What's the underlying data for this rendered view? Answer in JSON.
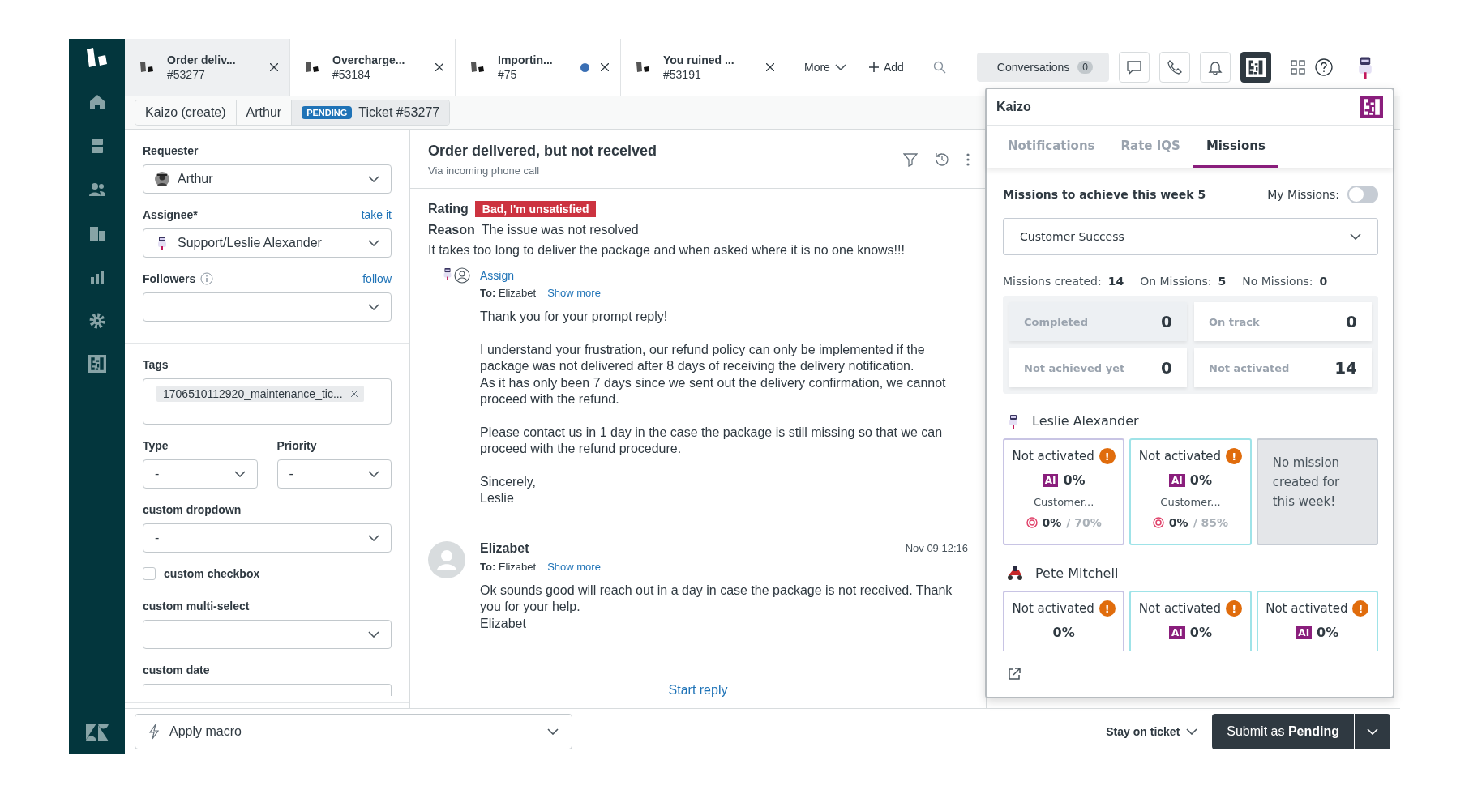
{
  "tabs": [
    {
      "title": "Order deliv...",
      "number": "#53277",
      "selected": true,
      "unread": false
    },
    {
      "title": "Overcharge...",
      "number": "#53184",
      "selected": false,
      "unread": false
    },
    {
      "title": "Importin...",
      "number": "#75",
      "selected": false,
      "unread": true
    },
    {
      "title": "You ruined ...",
      "number": "#53191",
      "selected": false,
      "unread": false
    }
  ],
  "toolbar": {
    "more": "More",
    "add": "Add",
    "conversations": {
      "label": "Conversations",
      "count": "0"
    },
    "buttons": [
      {
        "selected": false
      },
      {
        "selected": false
      },
      {
        "selected": false
      },
      {
        "selected": true
      }
    ]
  },
  "breadcrumb": [
    {
      "label": "Kaizo (create)",
      "selected": false
    },
    {
      "label": "Arthur",
      "selected": false
    },
    {
      "label": "Ticket #53277",
      "badge": "PENDING",
      "selected": true
    }
  ],
  "properties": [
    [
      {
        "kind": "select",
        "label": "Requester",
        "value": "Arthur",
        "avatar": true
      },
      {
        "kind": "select",
        "label": "Assignee*",
        "link": "take it",
        "value": "Support/Leslie Alexander",
        "avatar": true
      },
      {
        "kind": "select",
        "label": "Followers",
        "info": true,
        "link": "follow"
      }
    ],
    [
      {
        "kind": "tags",
        "label": "Tags",
        "tags": [
          "1706510112920_maintenance_tic..."
        ]
      },
      {
        "kind": "pair",
        "items": [
          {
            "label": "Type",
            "value": "-"
          },
          {
            "label": "Priority",
            "value": "-"
          }
        ]
      },
      {
        "kind": "select",
        "label": "custom dropdown",
        "value": "-"
      },
      {
        "kind": "checkbox",
        "label": "custom checkbox",
        "checked": false
      },
      {
        "kind": "select",
        "label": "custom multi-select"
      },
      {
        "kind": "date",
        "label": "custom date"
      }
    ]
  ],
  "ticket": {
    "title": "Order delivered, but not received",
    "via": "Via incoming phone call",
    "rating": {
      "label": "Rating",
      "value": "Bad, I'm unsatisfied",
      "reason_label": "Reason",
      "reason": "The issue was not resolved",
      "comment": "It takes too long to deliver the package and when asked where it is no one knows!!!"
    },
    "messages": [
      {
        "kind": "partial",
        "assign": "Assign",
        "to_label": "To:",
        "to": "Elizabet",
        "show_more": "Show more",
        "paragraphs": [
          "Thank you for your prompt reply!",
          "I understand your frustration, our refund policy can only be implemented if the package was not delivered after 8 days of receiving the delivery notification.\nAs it has only been 7 days since we sent out the delivery confirmation, we cannot proceed with the refund.",
          "Please contact us in 1 day in the case the package is still missing so that we can proceed with the refund procedure.",
          "Sincerely,\nLeslie"
        ]
      },
      {
        "kind": "full",
        "author": "Elizabet",
        "time": "Nov 09 12:16",
        "to_label": "To:",
        "to": "Elizabet",
        "show_more": "Show more",
        "paragraphs": [
          "Ok sounds good will reach out in a day in case the package is not received. Thank you for your help.\nElizabet"
        ]
      }
    ],
    "start_reply": "Start reply"
  },
  "footer": {
    "macro": "Apply macro",
    "stay": "Stay on ticket",
    "submit": "Submit as **Pending**"
  },
  "kaizo": {
    "title": "Kaizo",
    "tabs": [
      {
        "label": "Notifications",
        "selected": false
      },
      {
        "label": "Rate IQS",
        "selected": false
      },
      {
        "label": "Missions",
        "selected": true
      }
    ],
    "heading": "Missions to achieve this week 5",
    "my_missions": {
      "label": "My Missions:",
      "on": false
    },
    "team": "Customer Success",
    "stats": [
      {
        "label": "Missions created:",
        "value": "14"
      },
      {
        "label": "On Missions:",
        "value": "5"
      },
      {
        "label": "No Missions:",
        "value": "0"
      }
    ],
    "summary": [
      {
        "label": "Completed",
        "value": "0",
        "selected": true
      },
      {
        "label": "On track",
        "value": "0",
        "selected": false
      },
      {
        "label": "Not achieved yet",
        "value": "0",
        "selected": false
      },
      {
        "label": "Not activated",
        "value": "14",
        "selected": false
      }
    ],
    "agents": [
      {
        "name": "Leslie Alexander",
        "cards": [
          {
            "kind": "mission",
            "status": "Not activated",
            "warning": "!",
            "ai": "AI",
            "percent": "0%",
            "name": "Customer...",
            "progress": "0%",
            "target": "/ 70%",
            "color": "#c8c4e4"
          },
          {
            "kind": "mission",
            "status": "Not activated",
            "warning": "!",
            "ai": "AI",
            "percent": "0%",
            "name": "Customer...",
            "progress": "0%",
            "target": "/ 85%",
            "color": "#9fe3e8"
          },
          {
            "kind": "empty",
            "text": "No mission created for this week!"
          }
        ]
      },
      {
        "name": "Pete Mitchell",
        "cards": [
          {
            "kind": "mission",
            "status": "Not activated",
            "warning": "!",
            "percent": "0%",
            "color": "#c8c4e4"
          },
          {
            "kind": "mission",
            "status": "Not activated",
            "warning": "!",
            "ai": "AI",
            "percent": "0%",
            "color": "#9fe3e8"
          },
          {
            "kind": "mission",
            "status": "Not activated",
            "warning": "!",
            "ai": "AI",
            "percent": "0%",
            "color": "#9fe3e8"
          }
        ]
      }
    ]
  }
}
